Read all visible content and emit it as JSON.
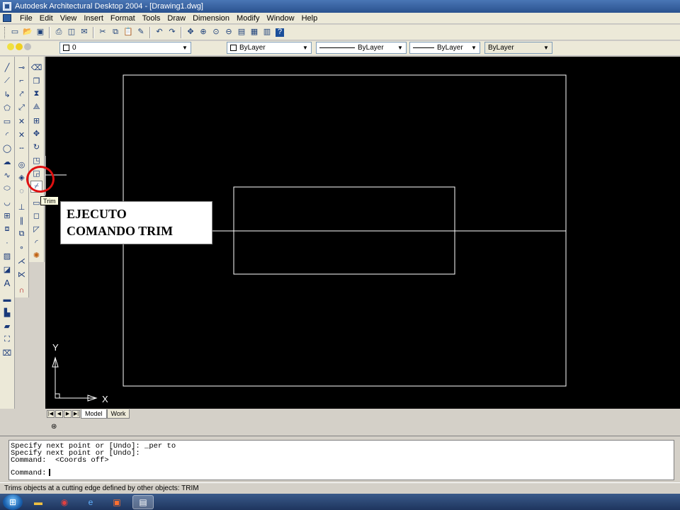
{
  "window": {
    "title": "Autodesk Architectural Desktop 2004 - [Drawing1.dwg]"
  },
  "menu": [
    "File",
    "Edit",
    "View",
    "Insert",
    "Format",
    "Tools",
    "Draw",
    "Dimension",
    "Modify",
    "Window",
    "Help"
  ],
  "properties": {
    "layer_value": "0",
    "color": "ByLayer",
    "linetype": "ByLayer",
    "lineweight": "ByLayer",
    "plotstyle": "ByLayer"
  },
  "tabs": {
    "model": "Model",
    "work": "Work"
  },
  "ucs": {
    "x_label": "X",
    "y_label": "Y"
  },
  "tooltip": "Trim",
  "annotation": {
    "line1": "EJECUTO",
    "line2": "COMANDO  TRIM"
  },
  "command_history": [
    "Specify next point or [Undo]: _per to",
    "Specify next point or [Undo]:",
    "Command:  <Coords off>"
  ],
  "command_prompt": "Command:",
  "status_text": "Trims objects at a cutting edge defined by other objects:  TRIM",
  "colors": {
    "canvas": "#000000",
    "geometry": "#ffffff",
    "highlight": "#e01010"
  }
}
